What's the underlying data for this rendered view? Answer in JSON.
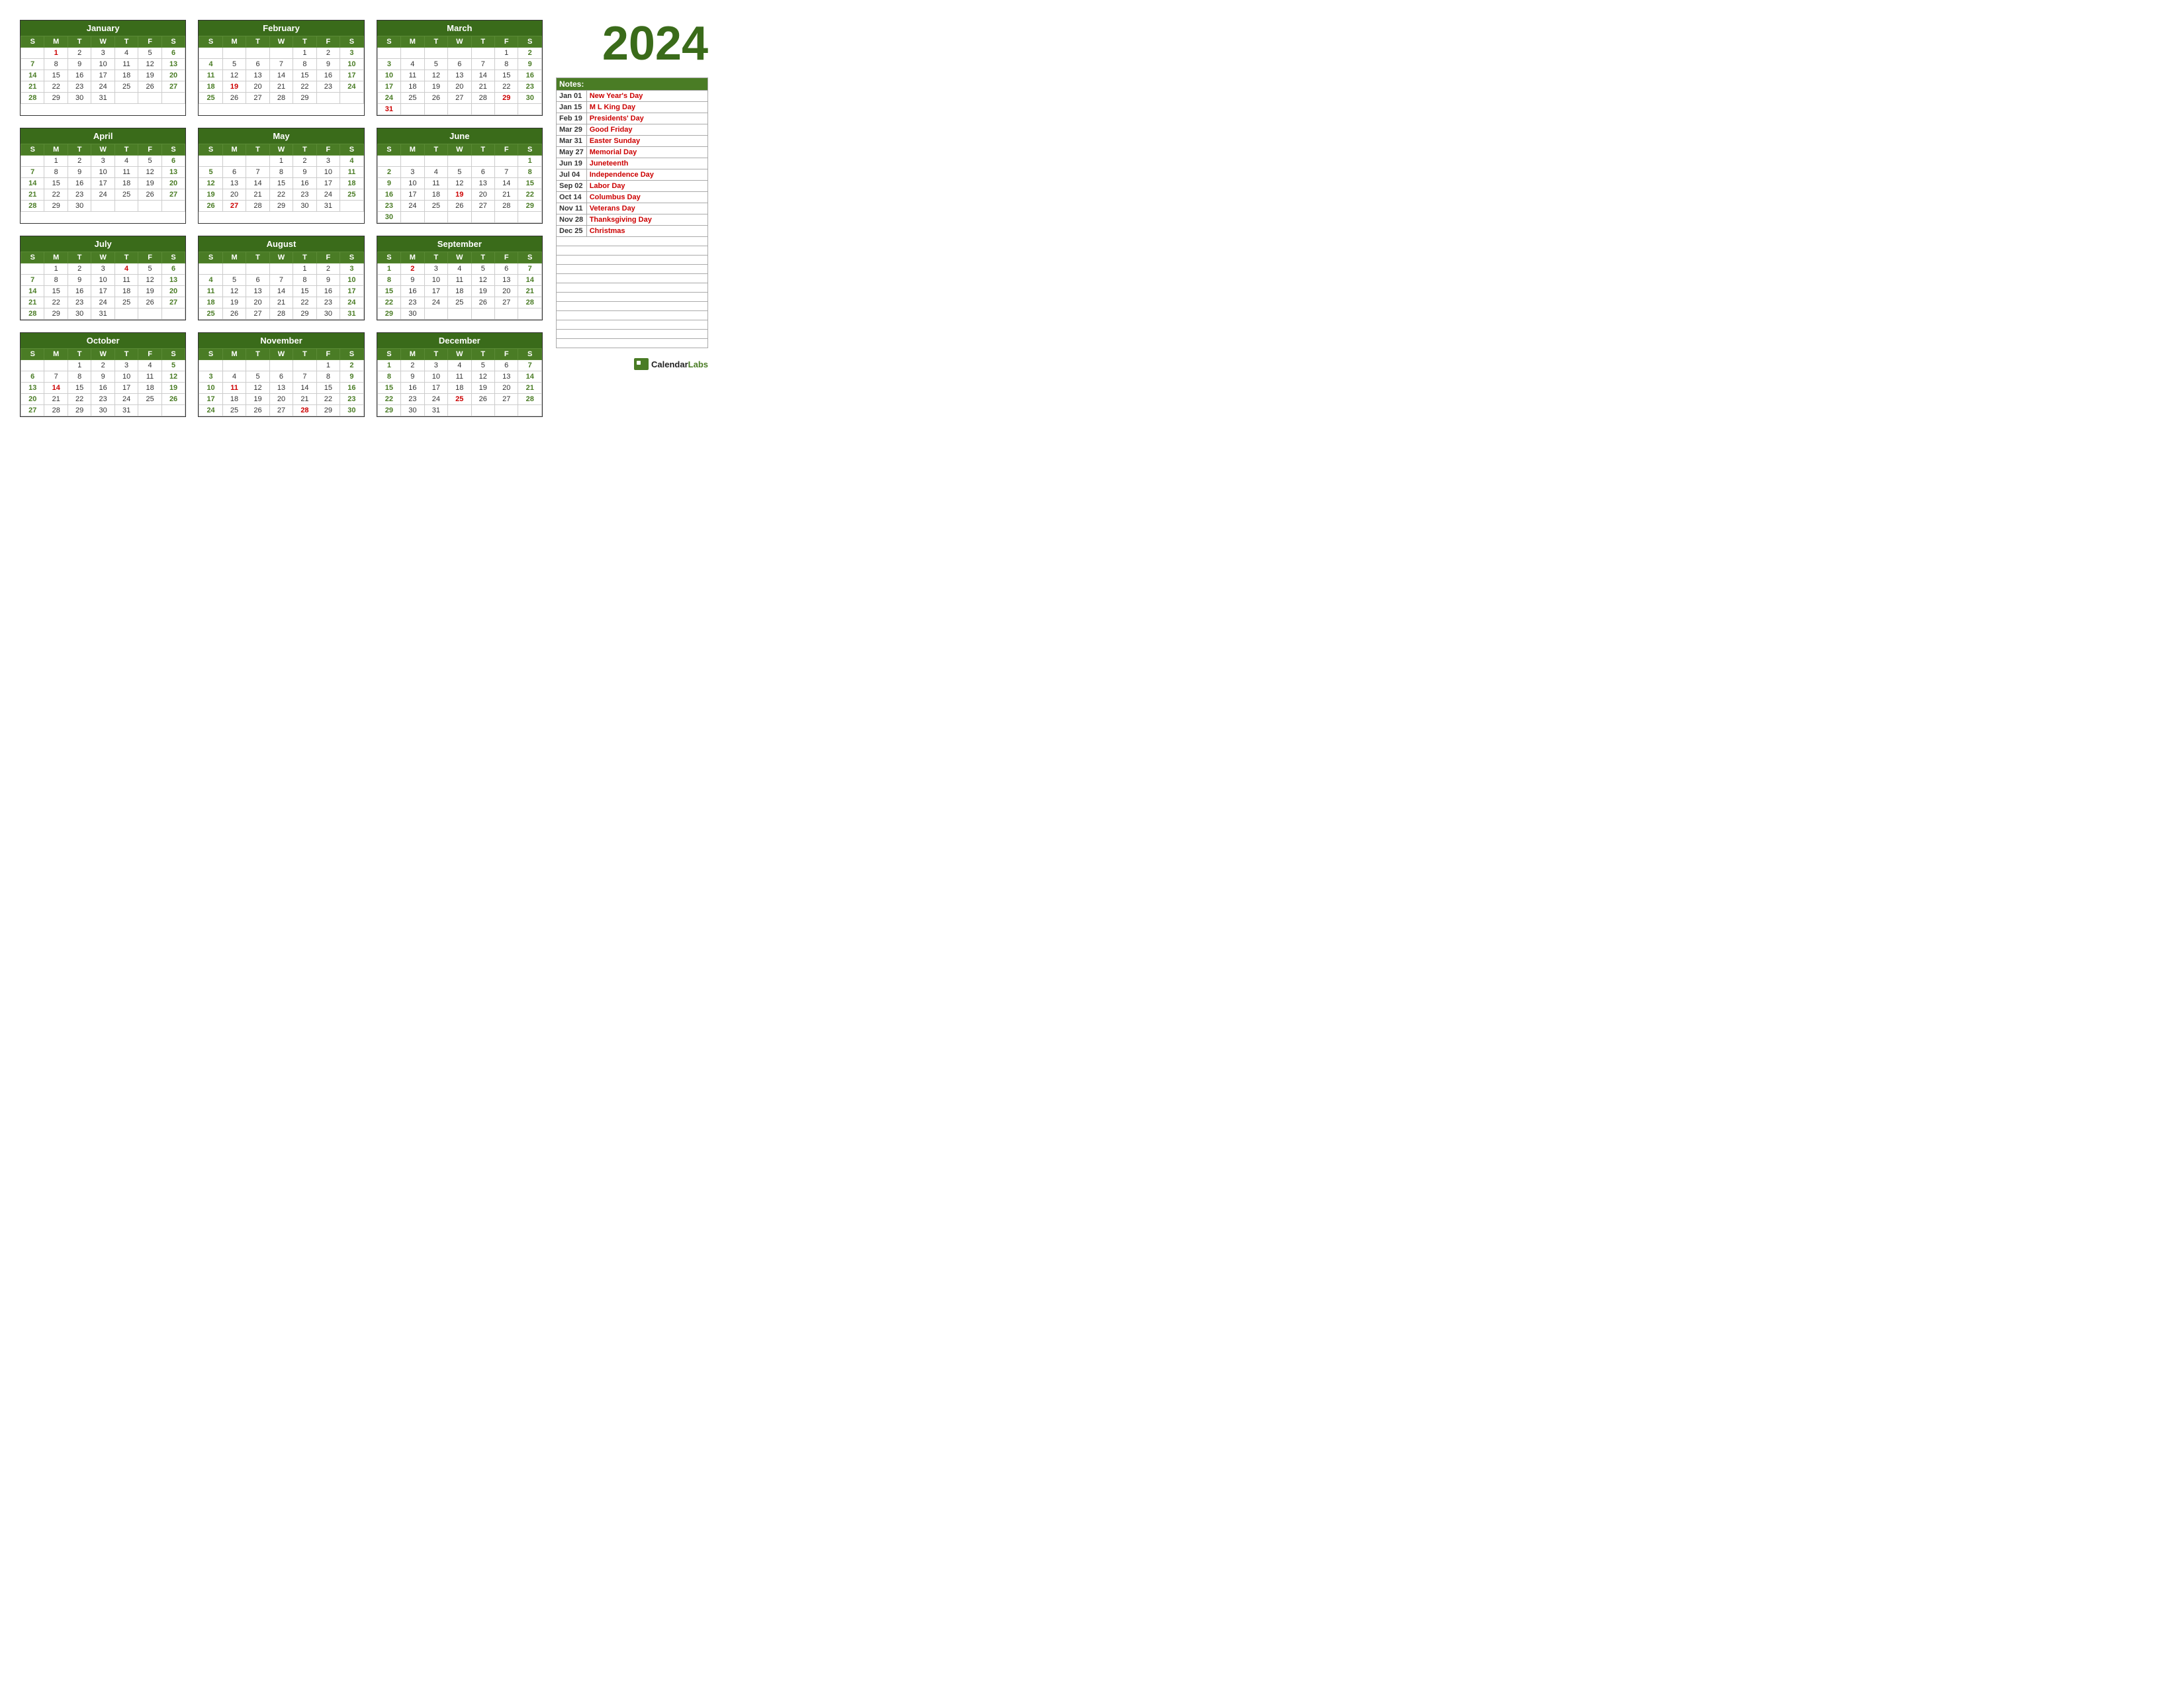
{
  "year": "2024",
  "months": [
    {
      "name": "January",
      "days": [
        {
          "week": [
            null,
            1,
            2,
            3,
            4,
            5,
            6
          ]
        },
        {
          "week": [
            7,
            8,
            9,
            10,
            11,
            12,
            13
          ]
        },
        {
          "week": [
            14,
            15,
            16,
            17,
            18,
            19,
            20
          ]
        },
        {
          "week": [
            21,
            22,
            23,
            24,
            25,
            26,
            27
          ]
        },
        {
          "week": [
            28,
            29,
            30,
            31,
            null,
            null,
            null
          ]
        }
      ],
      "holidays": [
        1
      ],
      "saturdays": [
        6,
        13,
        20,
        27
      ],
      "sundays": [
        7,
        14,
        21,
        28
      ]
    },
    {
      "name": "February",
      "days": [
        {
          "week": [
            null,
            null,
            null,
            null,
            1,
            2,
            3
          ]
        },
        {
          "week": [
            4,
            5,
            6,
            7,
            8,
            9,
            10
          ]
        },
        {
          "week": [
            11,
            12,
            13,
            14,
            15,
            16,
            17
          ]
        },
        {
          "week": [
            18,
            19,
            20,
            21,
            22,
            23,
            24
          ]
        },
        {
          "week": [
            25,
            26,
            27,
            28,
            29,
            null,
            null
          ]
        }
      ],
      "holidays": [
        19
      ],
      "saturdays": [
        3,
        10,
        17,
        24
      ],
      "sundays": [
        4,
        11,
        18,
        25
      ]
    },
    {
      "name": "March",
      "days": [
        {
          "week": [
            null,
            null,
            null,
            null,
            null,
            1,
            2
          ]
        },
        {
          "week": [
            3,
            4,
            5,
            6,
            7,
            8,
            9
          ]
        },
        {
          "week": [
            10,
            11,
            12,
            13,
            14,
            15,
            16
          ]
        },
        {
          "week": [
            17,
            18,
            19,
            20,
            21,
            22,
            23
          ]
        },
        {
          "week": [
            24,
            25,
            26,
            27,
            28,
            29,
            30
          ]
        },
        {
          "week": [
            31,
            null,
            null,
            null,
            null,
            null,
            null
          ]
        }
      ],
      "holidays": [
        29,
        31
      ],
      "saturdays": [
        2,
        9,
        16,
        23,
        30
      ],
      "sundays": [
        3,
        10,
        17,
        24,
        31
      ]
    },
    {
      "name": "April",
      "days": [
        {
          "week": [
            null,
            1,
            2,
            3,
            4,
            5,
            6
          ]
        },
        {
          "week": [
            7,
            8,
            9,
            10,
            11,
            12,
            13
          ]
        },
        {
          "week": [
            14,
            15,
            16,
            17,
            18,
            19,
            20
          ]
        },
        {
          "week": [
            21,
            22,
            23,
            24,
            25,
            26,
            27
          ]
        },
        {
          "week": [
            28,
            29,
            30,
            null,
            null,
            null,
            null
          ]
        }
      ],
      "holidays": [],
      "saturdays": [
        6,
        13,
        20,
        27
      ],
      "sundays": [
        7,
        14,
        21,
        28
      ]
    },
    {
      "name": "May",
      "days": [
        {
          "week": [
            null,
            null,
            null,
            1,
            2,
            3,
            4
          ]
        },
        {
          "week": [
            5,
            6,
            7,
            8,
            9,
            10,
            11
          ]
        },
        {
          "week": [
            12,
            13,
            14,
            15,
            16,
            17,
            18
          ]
        },
        {
          "week": [
            19,
            20,
            21,
            22,
            23,
            24,
            25
          ]
        },
        {
          "week": [
            26,
            27,
            28,
            29,
            30,
            31,
            null
          ]
        }
      ],
      "holidays": [
        27
      ],
      "saturdays": [
        4,
        11,
        18,
        25
      ],
      "sundays": [
        5,
        12,
        19,
        26
      ]
    },
    {
      "name": "June",
      "days": [
        {
          "week": [
            null,
            null,
            null,
            null,
            null,
            null,
            1
          ]
        },
        {
          "week": [
            2,
            3,
            4,
            5,
            6,
            7,
            8
          ]
        },
        {
          "week": [
            9,
            10,
            11,
            12,
            13,
            14,
            15
          ]
        },
        {
          "week": [
            16,
            17,
            18,
            19,
            20,
            21,
            22
          ]
        },
        {
          "week": [
            23,
            24,
            25,
            26,
            27,
            28,
            29
          ]
        },
        {
          "week": [
            30,
            null,
            null,
            null,
            null,
            null,
            null
          ]
        }
      ],
      "holidays": [
        19
      ],
      "saturdays": [
        1,
        8,
        15,
        22,
        29
      ],
      "sundays": [
        2,
        9,
        16,
        23,
        30
      ]
    },
    {
      "name": "July",
      "days": [
        {
          "week": [
            null,
            1,
            2,
            3,
            4,
            5,
            6
          ]
        },
        {
          "week": [
            7,
            8,
            9,
            10,
            11,
            12,
            13
          ]
        },
        {
          "week": [
            14,
            15,
            16,
            17,
            18,
            19,
            20
          ]
        },
        {
          "week": [
            21,
            22,
            23,
            24,
            25,
            26,
            27
          ]
        },
        {
          "week": [
            28,
            29,
            30,
            31,
            null,
            null,
            null
          ]
        }
      ],
      "holidays": [
        4
      ],
      "saturdays": [
        6,
        13,
        20,
        27
      ],
      "sundays": [
        7,
        14,
        21,
        28
      ]
    },
    {
      "name": "August",
      "days": [
        {
          "week": [
            null,
            null,
            null,
            null,
            1,
            2,
            3
          ]
        },
        {
          "week": [
            4,
            5,
            6,
            7,
            8,
            9,
            10
          ]
        },
        {
          "week": [
            11,
            12,
            13,
            14,
            15,
            16,
            17
          ]
        },
        {
          "week": [
            18,
            19,
            20,
            21,
            22,
            23,
            24
          ]
        },
        {
          "week": [
            25,
            26,
            27,
            28,
            29,
            30,
            31
          ]
        }
      ],
      "holidays": [],
      "saturdays": [
        3,
        10,
        17,
        24,
        31
      ],
      "sundays": [
        4,
        11,
        18,
        25
      ]
    },
    {
      "name": "September",
      "days": [
        {
          "week": [
            1,
            2,
            3,
            4,
            5,
            6,
            7
          ]
        },
        {
          "week": [
            8,
            9,
            10,
            11,
            12,
            13,
            14
          ]
        },
        {
          "week": [
            15,
            16,
            17,
            18,
            19,
            20,
            21
          ]
        },
        {
          "week": [
            22,
            23,
            24,
            25,
            26,
            27,
            28
          ]
        },
        {
          "week": [
            29,
            30,
            null,
            null,
            null,
            null,
            null
          ]
        }
      ],
      "holidays": [
        2
      ],
      "saturdays": [
        7,
        14,
        21,
        28
      ],
      "sundays": [
        1,
        8,
        15,
        22,
        29
      ]
    },
    {
      "name": "October",
      "days": [
        {
          "week": [
            null,
            null,
            1,
            2,
            3,
            4,
            5
          ]
        },
        {
          "week": [
            6,
            7,
            8,
            9,
            10,
            11,
            12
          ]
        },
        {
          "week": [
            13,
            14,
            15,
            16,
            17,
            18,
            19
          ]
        },
        {
          "week": [
            20,
            21,
            22,
            23,
            24,
            25,
            26
          ]
        },
        {
          "week": [
            27,
            28,
            29,
            30,
            31,
            null,
            null
          ]
        }
      ],
      "holidays": [
        14
      ],
      "saturdays": [
        5,
        12,
        19,
        26
      ],
      "sundays": [
        6,
        13,
        20,
        27
      ]
    },
    {
      "name": "November",
      "days": [
        {
          "week": [
            null,
            null,
            null,
            null,
            null,
            1,
            2
          ]
        },
        {
          "week": [
            3,
            4,
            5,
            6,
            7,
            8,
            9
          ]
        },
        {
          "week": [
            10,
            11,
            12,
            13,
            14,
            15,
            16
          ]
        },
        {
          "week": [
            17,
            18,
            19,
            20,
            21,
            22,
            23
          ]
        },
        {
          "week": [
            24,
            25,
            26,
            27,
            28,
            29,
            30
          ]
        }
      ],
      "holidays": [
        11,
        28
      ],
      "saturdays": [
        2,
        9,
        16,
        23,
        30
      ],
      "sundays": [
        3,
        10,
        17,
        24
      ]
    },
    {
      "name": "December",
      "days": [
        {
          "week": [
            1,
            2,
            3,
            4,
            5,
            6,
            7
          ]
        },
        {
          "week": [
            8,
            9,
            10,
            11,
            12,
            13,
            14
          ]
        },
        {
          "week": [
            15,
            16,
            17,
            18,
            19,
            20,
            21
          ]
        },
        {
          "week": [
            22,
            23,
            24,
            25,
            26,
            27,
            28
          ]
        },
        {
          "week": [
            29,
            30,
            31,
            null,
            null,
            null,
            null
          ]
        }
      ],
      "holidays": [
        25
      ],
      "saturdays": [
        7,
        14,
        21,
        28
      ],
      "sundays": [
        1,
        8,
        15,
        22,
        29
      ]
    }
  ],
  "notes_header": "Notes:",
  "holidays_list": [
    {
      "date": "Jan 01",
      "name": "New Year's Day"
    },
    {
      "date": "Jan 15",
      "name": "M L King Day"
    },
    {
      "date": "Feb 19",
      "name": "Presidents' Day"
    },
    {
      "date": "Mar 29",
      "name": "Good Friday"
    },
    {
      "date": "Mar 31",
      "name": "Easter Sunday"
    },
    {
      "date": "May 27",
      "name": "Memorial Day"
    },
    {
      "date": "Jun 19",
      "name": "Juneteenth"
    },
    {
      "date": "Jul 04",
      "name": "Independence Day"
    },
    {
      "date": "Sep 02",
      "name": "Labor Day"
    },
    {
      "date": "Oct 14",
      "name": "Columbus Day"
    },
    {
      "date": "Nov 11",
      "name": "Veterans Day"
    },
    {
      "date": "Nov 28",
      "name": "Thanksgiving Day"
    },
    {
      "date": "Dec 25",
      "name": "Christmas"
    }
  ],
  "weekday_headers": [
    "S",
    "M",
    "T",
    "W",
    "T",
    "F",
    "S"
  ],
  "logo_text": "CalendarLabs"
}
